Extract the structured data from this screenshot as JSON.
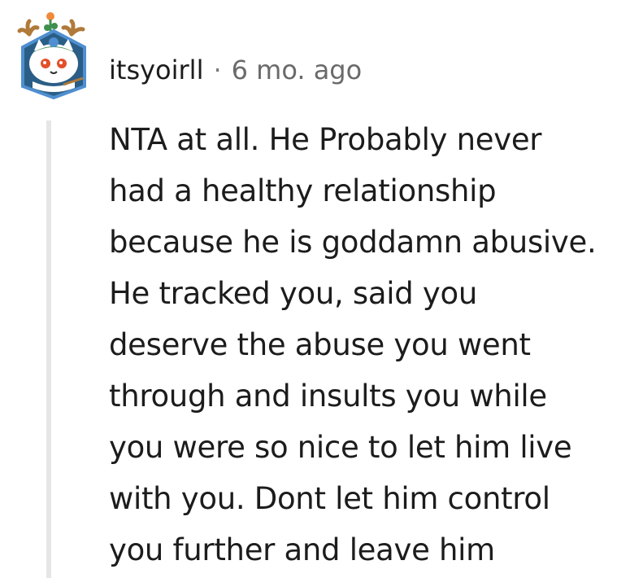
{
  "comment": {
    "username": "itsyoirll",
    "separator": "·",
    "timestamp": "6 mo. ago",
    "avatar_icon": "snow-cat-avatar-icon",
    "body_lines": [
      "NTA at all. He Probably never",
      "had a healthy relationship",
      "because he is goddamn abusive.",
      "He tracked you, said you",
      "deserve the abuse you went",
      "through and insults you while",
      "you were so nice to let him live",
      "with you. Dont let him control",
      "you further and leave him"
    ]
  },
  "colors": {
    "text": "#1c1c1c",
    "meta": "#6a6a6a",
    "thread_line": "#e6e6e6",
    "avatar_border": "#4f8fd0",
    "avatar_bg": "#2a5e86",
    "antler": "#b07a3a",
    "leaf": "#3f8f4f",
    "eye": "#e2502a"
  }
}
